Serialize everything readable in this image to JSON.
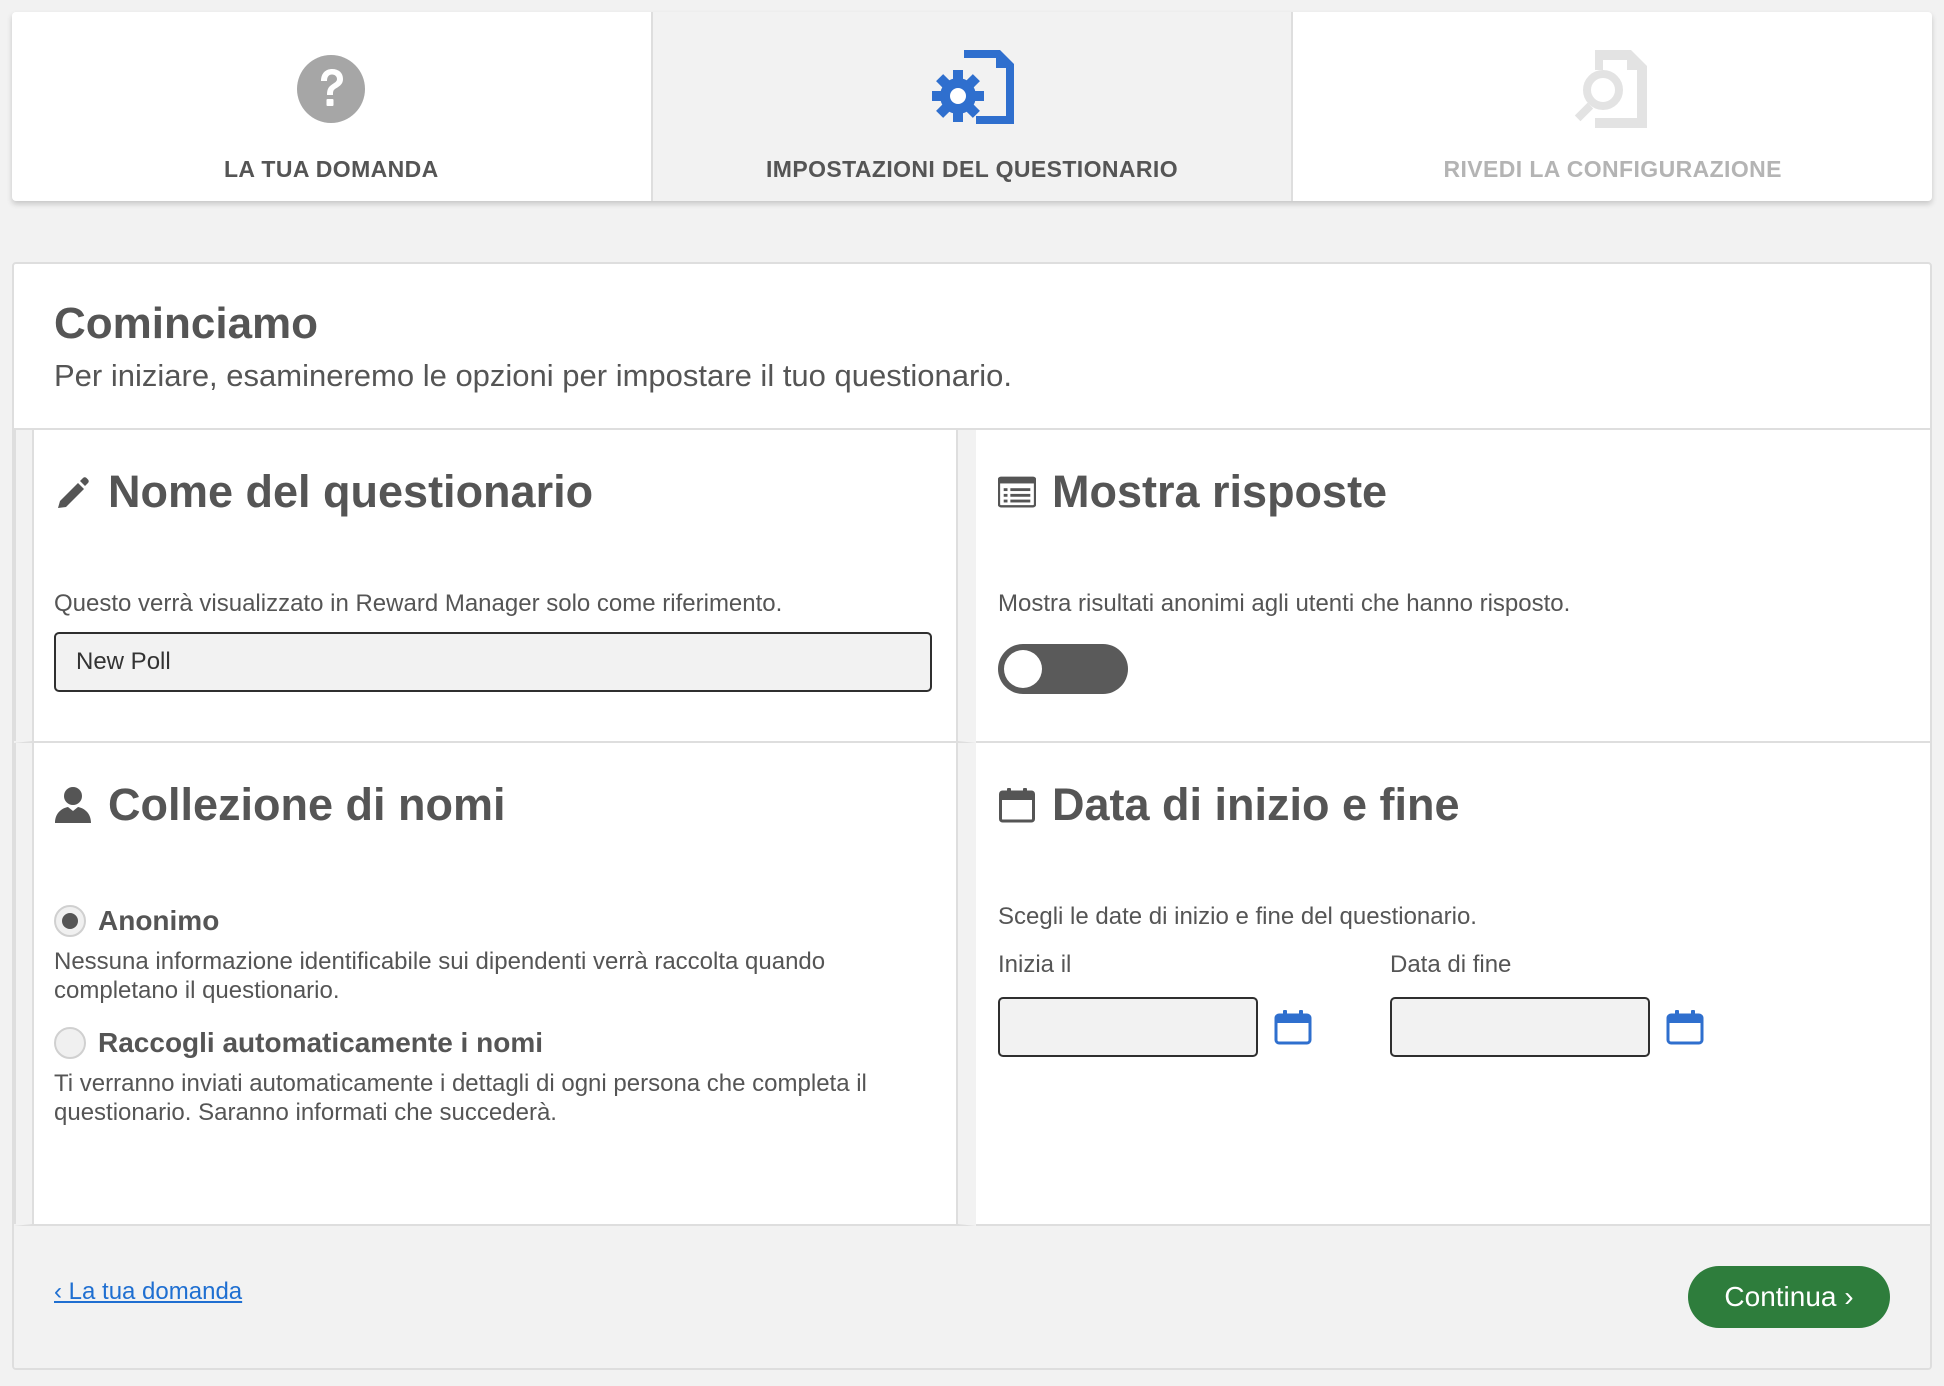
{
  "stepper": {
    "steps": [
      {
        "label": "LA TUA DOMANDA",
        "icon": "question-circle-icon",
        "state": "completed"
      },
      {
        "label": "IMPOSTAZIONI DEL QUESTIONARIO",
        "icon": "settings-document-icon",
        "state": "active"
      },
      {
        "label": "RIVEDI LA CONFIGURAZIONE",
        "icon": "review-document-icon",
        "state": "disabled"
      }
    ]
  },
  "intro": {
    "title": "Cominciamo",
    "subtitle": "Per iniziare, esamineremo le opzioni per impostare il tuo questionario."
  },
  "poll_name": {
    "title": "Nome del questionario",
    "icon": "pencil-icon",
    "description": "Questo verrà visualizzato in Reward Manager solo come riferimento.",
    "value": "New Poll"
  },
  "show_responses": {
    "title": "Mostra risposte",
    "icon": "list-icon",
    "description": "Mostra risultati anonimi agli utenti che hanno risposto.",
    "enabled": false
  },
  "name_collection": {
    "title": "Collezione di nomi",
    "icon": "user-icon",
    "options": [
      {
        "label": "Anonimo",
        "description": "Nessuna informazione identificabile sui dipendenti verrà raccolta quando completano il questionario.",
        "selected": true
      },
      {
        "label": "Raccogli automaticamente i nomi",
        "description": "Ti verranno inviati automaticamente i dettagli di ogni persona che completa il questionario. Saranno informati che succederà.",
        "selected": false
      }
    ]
  },
  "dates": {
    "title": "Data di inizio e fine",
    "icon": "calendar-icon",
    "description": "Scegli le date di inizio e fine del questionario.",
    "start_label": "Inizia il",
    "end_label": "Data di fine",
    "start_value": "",
    "end_value": ""
  },
  "footer": {
    "back_label": "‹ La tua domanda",
    "continue_label": "Continua ›"
  },
  "colors": {
    "accent_blue": "#2f6fce",
    "continue_green": "#2e7d3c",
    "link_blue": "#1f6fd1"
  }
}
